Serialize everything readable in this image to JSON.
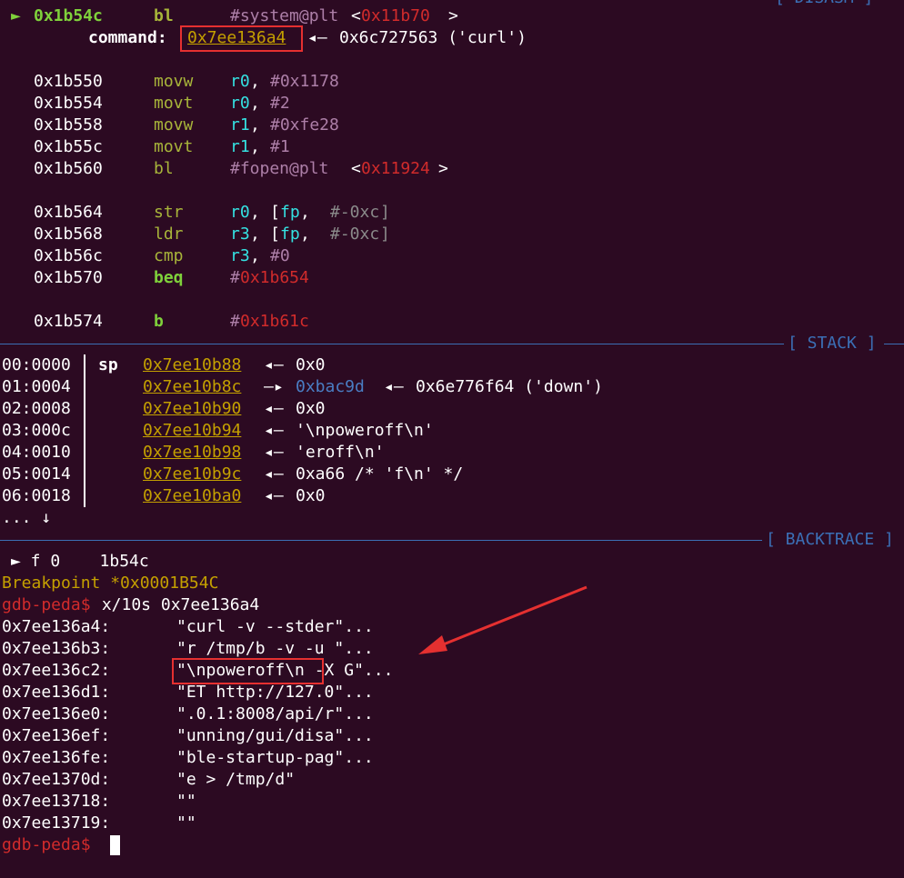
{
  "disasm": {
    "header_partial": "[ DISASM ]",
    "current": {
      "marker": "►",
      "addr": "0x1b54c",
      "mnemonic": "bl",
      "target": "#system@plt",
      "target_addr": "0x11b70"
    },
    "command": {
      "label": "command:",
      "ptr": "0x7ee136a4",
      "arrow": "◂—",
      "value": "0x6c727563 ('curl')"
    },
    "instructions": [
      {
        "addr": "0x1b550",
        "mn": "movw",
        "r": "r0",
        "imm": "#0x1178"
      },
      {
        "addr": "0x1b554",
        "mn": "movt",
        "r": "r0",
        "imm": "#2"
      },
      {
        "addr": "0x1b558",
        "mn": "movw",
        "r": "r1",
        "imm": "#0xfe28"
      },
      {
        "addr": "0x1b55c",
        "mn": "movt",
        "r": "r1",
        "imm": "#1"
      },
      {
        "addr": "0x1b560",
        "mn": "bl",
        "target": "#fopen@plt",
        "target_addr": "0x11924"
      },
      {
        "addr": "0x1b564",
        "mn": "str",
        "r": "r0",
        "mem_reg": "fp",
        "mem_off": "#-0xc"
      },
      {
        "addr": "0x1b568",
        "mn": "ldr",
        "r": "r3",
        "mem_reg": "fp",
        "mem_off": "#-0xc"
      },
      {
        "addr": "0x1b56c",
        "mn": "cmp",
        "r": "r3",
        "imm": "#0"
      },
      {
        "addr": "0x1b570",
        "mn": "beq",
        "hash": "#",
        "target": "0x1b654"
      },
      {
        "addr": "0x1b574",
        "mn": "b",
        "hash": "#",
        "target": "0x1b61c"
      }
    ]
  },
  "stack": {
    "header": "[ STACK ]",
    "sp_label": "sp",
    "rows": [
      {
        "idx": "00:0000",
        "addr": "0x7ee10b88",
        "arrow": "◂—",
        "val": "0x0"
      },
      {
        "idx": "01:0004",
        "addr": "0x7ee10b8c",
        "arrow": "—▸",
        "ptr": "0xbac9d",
        "arrow2": "◂—",
        "val": "0x6e776f64 ('down')"
      },
      {
        "idx": "02:0008",
        "addr": "0x7ee10b90",
        "arrow": "◂—",
        "val": "0x0"
      },
      {
        "idx": "03:000c",
        "addr": "0x7ee10b94",
        "arrow": "◂—",
        "val": "'\\npoweroff\\n'"
      },
      {
        "idx": "04:0010",
        "addr": "0x7ee10b98",
        "arrow": "◂—",
        "val": "'eroff\\n'"
      },
      {
        "idx": "05:0014",
        "addr": "0x7ee10b9c",
        "arrow": "◂—",
        "val": "0xa66 /* 'f\\n' */"
      },
      {
        "idx": "06:0018",
        "addr": "0x7ee10ba0",
        "arrow": "◂—",
        "val": "0x0"
      }
    ],
    "more": "... ↓"
  },
  "backtrace": {
    "header": "[ BACKTRACE ]",
    "frame": "► f 0    1b54c"
  },
  "console": {
    "breakpoint": "Breakpoint *0x0001B54C",
    "prompt": "gdb-peda$",
    "command": " x/10s 0x7ee136a4",
    "strings": [
      {
        "addr": "0x7ee136a4:",
        "val": "\"curl -v --stder\"..."
      },
      {
        "addr": "0x7ee136b3:",
        "val": "\"r /tmp/b -v -u \"..."
      },
      {
        "addr": "0x7ee136c2:",
        "val": "\"\\npoweroff\\n -X G\"..."
      },
      {
        "addr": "0x7ee136d1:",
        "val": "\"ET http://127.0\"..."
      },
      {
        "addr": "0x7ee136e0:",
        "val": "\".0.1:8008/api/r\"..."
      },
      {
        "addr": "0x7ee136ef:",
        "val": "\"unning/gui/disa\"..."
      },
      {
        "addr": "0x7ee136fe:",
        "val": "\"ble-startup-pag\"..."
      },
      {
        "addr": "0x7ee1370d:",
        "val": "\"e > /tmp/d\""
      },
      {
        "addr": "0x7ee13718:",
        "val": "\"\""
      },
      {
        "addr": "0x7ee13719:",
        "val": "\"\""
      }
    ]
  },
  "colors": {
    "background": "#2c0a22",
    "accent_green": "#7fd13b",
    "address_yellow": "#c4a000",
    "annotation_red": "#e53030",
    "rule_blue": "#3b6fb5"
  }
}
